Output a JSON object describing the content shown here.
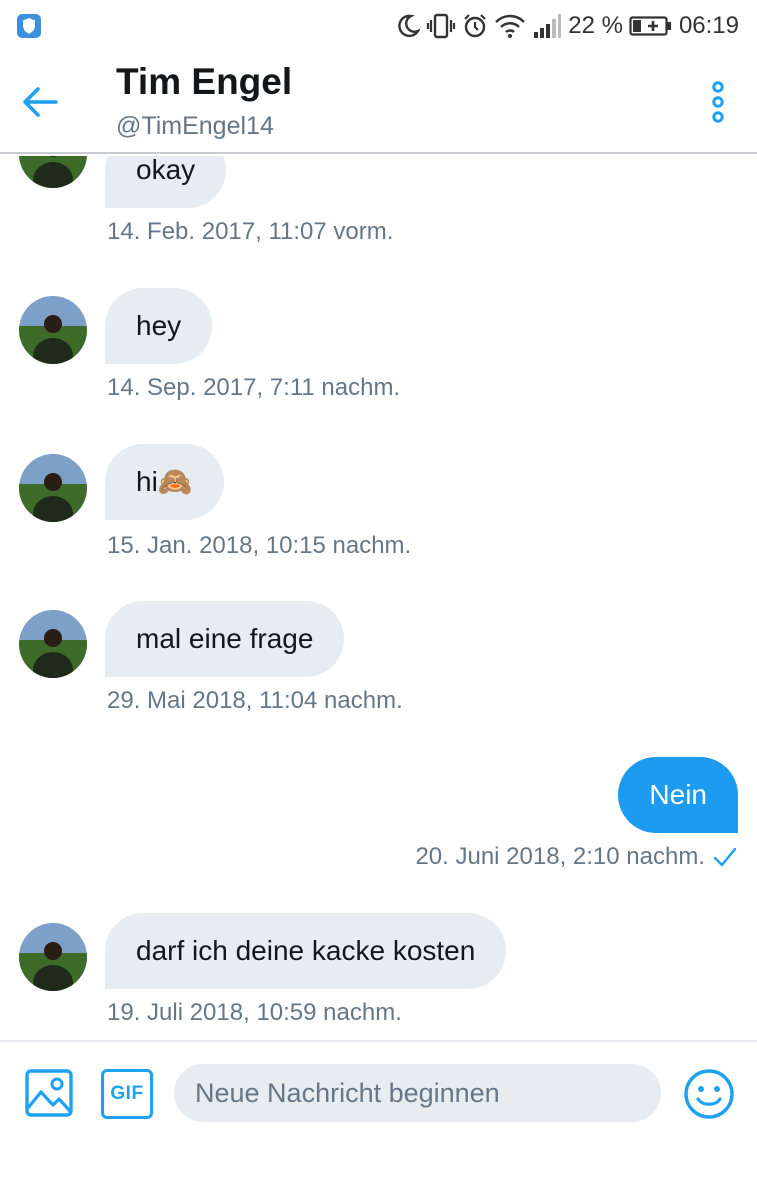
{
  "status_bar": {
    "battery_percent": "22 %",
    "time": "06:19",
    "icons": [
      "shield-icon",
      "moon-icon",
      "vibrate-icon",
      "alarm-icon",
      "wifi-icon",
      "signal-icon",
      "battery-charging-icon"
    ]
  },
  "header": {
    "name": "Tim Engel",
    "handle": "@TimEngel14",
    "back_icon": "back-arrow-icon",
    "more_icon": "more-options-icon"
  },
  "colors": {
    "accent": "#1da1f2",
    "outgoing_bubble": "#1d9bf0",
    "incoming_bubble": "#e6ecf0",
    "meta_text": "#657786",
    "primary_text": "#14171a"
  },
  "messages": [
    {
      "direction": "incoming",
      "text": "okay",
      "timestamp": "14. Feb. 2017, 11:07 vorm."
    },
    {
      "direction": "incoming",
      "text": "hey",
      "timestamp": "14. Sep. 2017, 7:11 nachm."
    },
    {
      "direction": "incoming",
      "text": "hi🙈",
      "timestamp": "15. Jan. 2018, 10:15 nachm."
    },
    {
      "direction": "incoming",
      "text": "mal eine frage",
      "timestamp": "29. Mai 2018, 11:04 nachm."
    },
    {
      "direction": "outgoing",
      "text": "Nein",
      "timestamp": "20. Juni 2018, 2:10 nachm.",
      "read_icon": "checkmark-icon"
    },
    {
      "direction": "incoming",
      "text": "darf ich deine kacke kosten",
      "timestamp": "19. Juli 2018, 10:59 nachm."
    }
  ],
  "composer": {
    "placeholder": "Neue Nachricht beginnen",
    "gif_label": "GIF",
    "media_icon": "image-icon",
    "emoji_icon": "emoji-icon"
  }
}
